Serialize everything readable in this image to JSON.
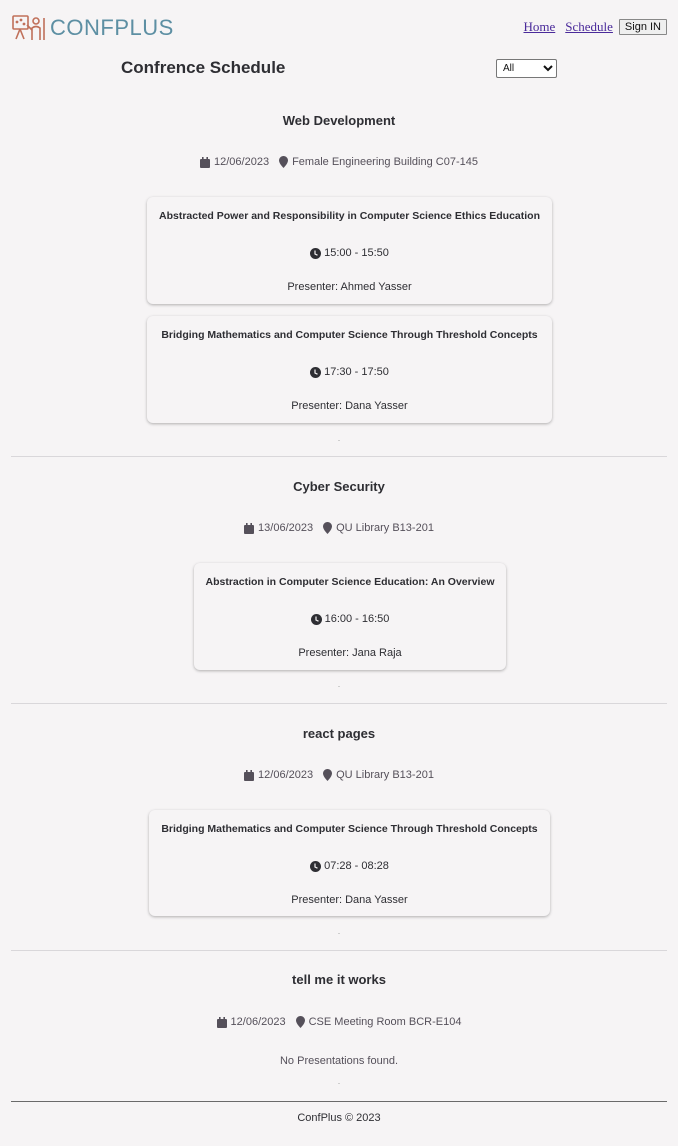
{
  "header": {
    "logo_text": "CONFPLUS",
    "nav": {
      "home_label": "Home",
      "schedule_label": "Schedule",
      "signin_label": "Sign IN"
    }
  },
  "page": {
    "title": "Confrence Schedule",
    "filter": {
      "selected": "All"
    }
  },
  "sessions": [
    {
      "title": "Web Development",
      "date": "12/06/2023",
      "location": "Female Engineering Building C07-145",
      "presentations": [
        {
          "title": "Abstracted Power and Responsibility in Computer Science Ethics Education",
          "time": "15:00 - 15:50",
          "presenter": "Presenter: Ahmed Yasser"
        },
        {
          "title": "Bridging Mathematics and Computer Science Through Threshold Concepts",
          "time": "17:30 - 17:50",
          "presenter": "Presenter: Dana Yasser"
        }
      ]
    },
    {
      "title": "Cyber Security",
      "date": "13/06/2023",
      "location": "QU Library B13-201",
      "presentations": [
        {
          "title": "Abstraction in Computer Science Education: An Overview",
          "time": "16:00 - 16:50",
          "presenter": "Presenter: Jana Raja"
        }
      ]
    },
    {
      "title": "react pages",
      "date": "12/06/2023",
      "location": "QU Library B13-201",
      "presentations": [
        {
          "title": "Bridging Mathematics and Computer Science Through Threshold Concepts",
          "time": "07:28 - 08:28",
          "presenter": "Presenter: Dana Yasser"
        }
      ]
    },
    {
      "title": "tell me it works",
      "date": "12/06/2023",
      "location": "CSE Meeting Room BCR-E104",
      "presentations": [],
      "empty_message": "No Presentations found."
    }
  ],
  "footer": {
    "text": "ConfPlus © 2023"
  },
  "colors": {
    "background": "#f6f4f5",
    "logo": "#5d8fa3",
    "logo_mark": "#c0705a",
    "link": "#4a2a9a",
    "text": "#2e2e33",
    "muted": "#55505a"
  },
  "icons": {
    "date": "calendar-icon",
    "location": "map-pin-icon",
    "time": "clock-icon"
  }
}
